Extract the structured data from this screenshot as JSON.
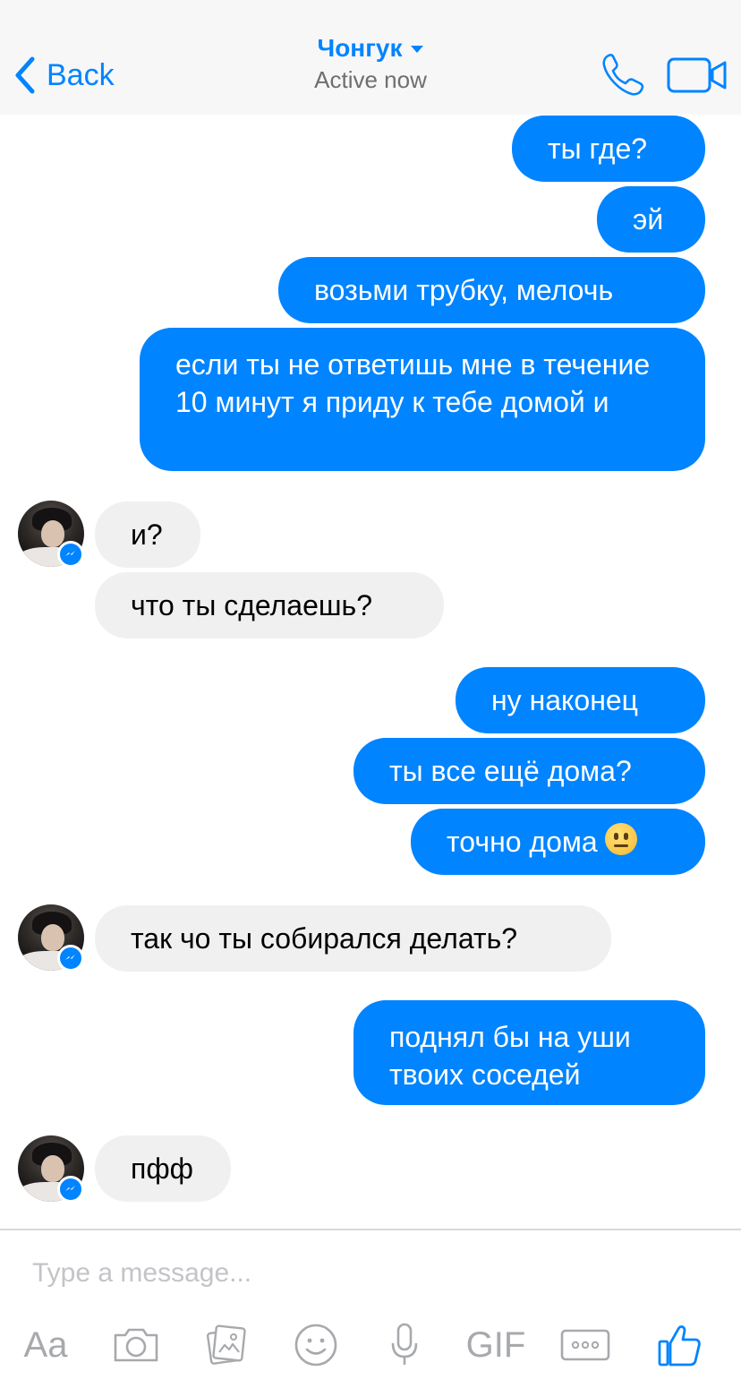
{
  "header": {
    "back_label": "Back",
    "contact_name": "Чонгук",
    "status": "Active now",
    "icons": [
      "chevron-left-icon",
      "caret-down-icon",
      "phone-icon",
      "video-camera-icon"
    ]
  },
  "messages": [
    {
      "from": "me",
      "text": "ты где?"
    },
    {
      "from": "me",
      "text": "эй"
    },
    {
      "from": "me",
      "text": "возьми трубку, мелочь"
    },
    {
      "from": "me",
      "text": "если ты не ответишь мне в течение 10 минут я приду к тебе домой и"
    },
    {
      "from": "contact",
      "text": "и?"
    },
    {
      "from": "contact",
      "text": "что ты сделаешь?"
    },
    {
      "from": "me",
      "text": "ну наконец"
    },
    {
      "from": "me",
      "text": "ты все ещё дома?"
    },
    {
      "from": "me",
      "text": "точно дома",
      "emoji": "neutral-face-emoji"
    },
    {
      "from": "contact",
      "text": "так чо ты собирался делать?"
    },
    {
      "from": "me",
      "text": "поднял бы на уши твоих соседей"
    },
    {
      "from": "contact",
      "text": "пфф"
    }
  ],
  "composer": {
    "placeholder": "Type a message..."
  },
  "toolbar": {
    "text_label": "Aa",
    "gif_label": "GIF",
    "icons": [
      "camera-icon",
      "gallery-icon",
      "emoji-icon",
      "microphone-icon",
      "more-icon",
      "thumbs-up-icon"
    ]
  },
  "colors": {
    "accent": "#0084ff",
    "incoming_bubble": "#f1f0f0",
    "header_bg": "#f7f7f7",
    "toolbar_gray": "#a7a9ad"
  }
}
